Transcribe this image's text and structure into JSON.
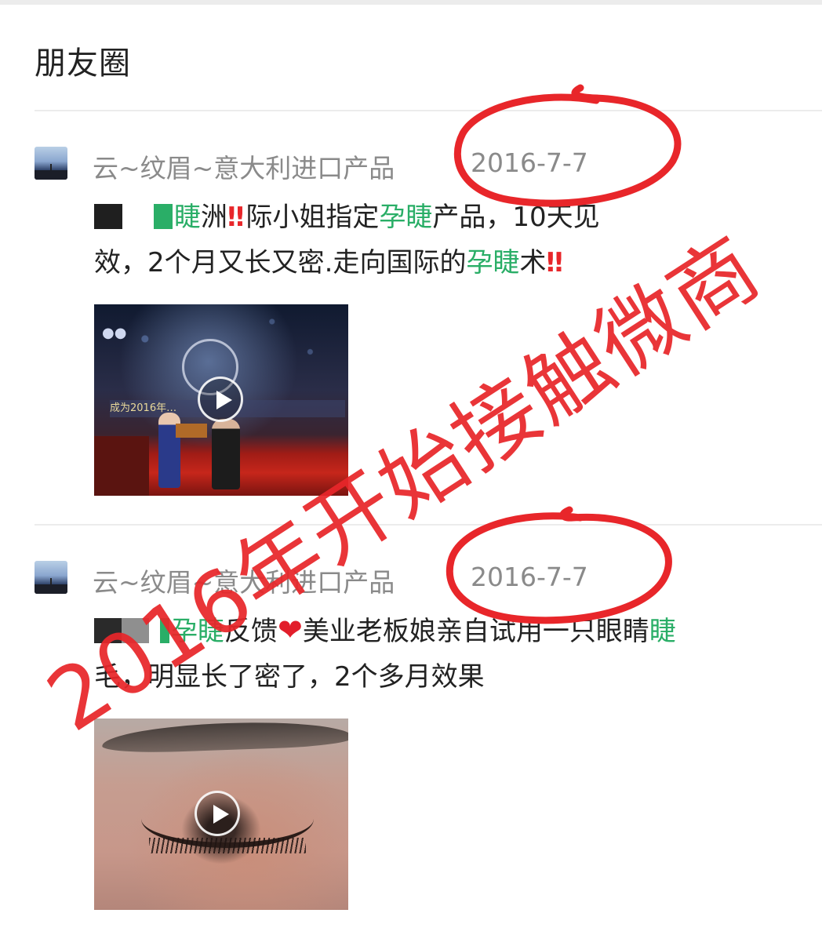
{
  "header": {
    "title": "朋友圈"
  },
  "posts": [
    {
      "author": "云~纹眉~意大利进口产品",
      "date": "2016-7-7",
      "text_line1_hl1": "睫",
      "text_line1_a": "洲",
      "text_line1_b": "际小姐指定",
      "text_line1_hl2": "孕睫",
      "text_line1_c": "产品，10天见",
      "text_line2_a": "效，2个月又长又密.走向国际的",
      "text_line2_hl": "孕睫",
      "text_line2_b": "术",
      "bang": "‼",
      "media": {
        "type": "video",
        "banner": "成为2016年…"
      }
    },
    {
      "author": "云~纹眉~意大利进口产品",
      "date": "2016-7-7",
      "text_hl1": "孕睫",
      "text_a": "反馈",
      "heart": "❤",
      "text_b": "美业老板娘亲自试用一只眼睛",
      "text_hl2": "睫",
      "text_line2": "毛，明显长了密了，2个多月效果",
      "media": {
        "type": "video"
      }
    }
  ],
  "annotation": {
    "stamp_text": "2016年开始接触微商",
    "color": "#e8262a"
  },
  "colors": {
    "highlight": "#2aae67",
    "meta": "#8a8a8a",
    "annotation": "#e8262a"
  }
}
